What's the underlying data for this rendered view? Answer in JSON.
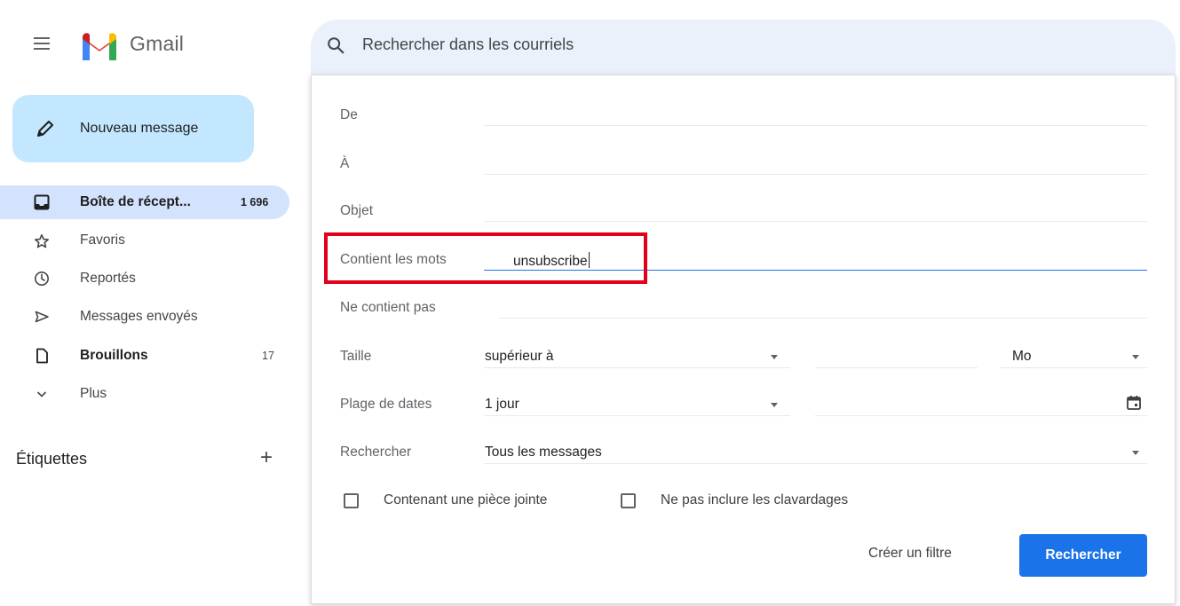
{
  "app": {
    "name": "Gmail"
  },
  "search": {
    "placeholder": "Rechercher dans les courriels"
  },
  "compose": {
    "label": "Nouveau message"
  },
  "nav": {
    "inbox": {
      "label": "Boîte de récept...",
      "count": "1 696"
    },
    "starred": {
      "label": "Favoris"
    },
    "snoozed": {
      "label": "Reportés"
    },
    "sent": {
      "label": "Messages envoyés"
    },
    "drafts": {
      "label": "Brouillons",
      "count": "17"
    },
    "more": {
      "label": "Plus"
    }
  },
  "labels": {
    "title": "Étiquettes",
    "add_symbol": "+"
  },
  "panel": {
    "from_label": "De",
    "to_label": "À",
    "subject_label": "Objet",
    "has_words_label": "Contient les mots",
    "has_words_value": "unsubscribe",
    "doesnt_have_label": "Ne contient pas",
    "size_label": "Taille",
    "size_op_value": "supérieur à",
    "size_unit_value": "Mo",
    "date_label": "Plage de dates",
    "date_value": "1 jour",
    "search_in_label": "Rechercher",
    "search_in_value": "Tous les messages",
    "attachment_label": "Contenant une pièce jointe",
    "no_chats_label": "Ne pas inclure les clavardages",
    "create_filter_label": "Créer un filtre",
    "search_button_label": "Rechercher"
  },
  "colors": {
    "accent": "#1a73e8",
    "highlight": "#e3001b",
    "compose_bg": "#c2e7ff",
    "active_nav_bg": "#d3e3fd"
  }
}
